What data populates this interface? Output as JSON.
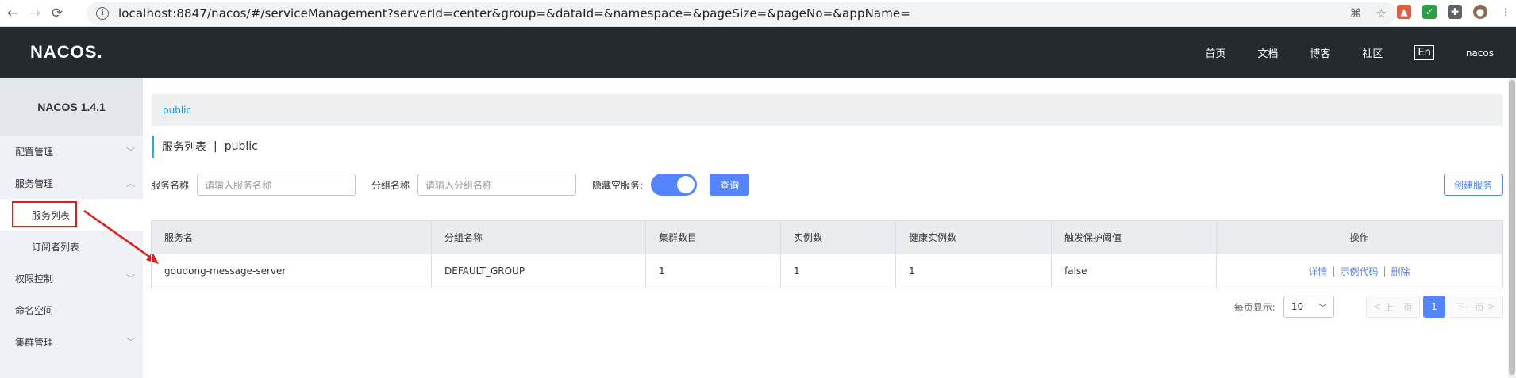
{
  "browser": {
    "url": "localhost:8847/nacos/#/serviceManagement?serverId=center&group=&dataId=&namespace=&pageSize=&pageNo=&appName="
  },
  "header": {
    "logo": "NACOS.",
    "nav": [
      "首页",
      "文档",
      "博客",
      "社区"
    ],
    "lang": "En",
    "user": "nacos"
  },
  "sidebar": {
    "title": "NACOS 1.4.1",
    "items": [
      {
        "label": "配置管理"
      },
      {
        "label": "服务管理"
      },
      {
        "label": "服务列表"
      },
      {
        "label": "订阅者列表"
      },
      {
        "label": "权限控制"
      },
      {
        "label": "命名空间"
      },
      {
        "label": "集群管理"
      }
    ]
  },
  "main": {
    "namespace_tab": "public",
    "page_title": "服务列表",
    "title_sep": "|",
    "page_namespace": "public",
    "filters": {
      "service_name_label": "服务名称",
      "service_name_placeholder": "请输入服务名称",
      "group_label": "分组名称",
      "group_placeholder": "请输入分组名称",
      "hide_empty_label": "隐藏空服务:",
      "hide_empty_on": true,
      "search_button": "查询",
      "create_button": "创建服务"
    },
    "table": {
      "headers": [
        "服务名",
        "分组名称",
        "集群数目",
        "实例数",
        "健康实例数",
        "触发保护阈值",
        "操作"
      ],
      "rows": [
        {
          "name": "goudong-message-server",
          "group": "DEFAULT_GROUP",
          "clusters": "1",
          "instances": "1",
          "healthy": "1",
          "protect": "false",
          "ops": [
            "详情",
            "示例代码",
            "删除"
          ]
        }
      ]
    },
    "pagination": {
      "label": "每页显示:",
      "page_size": "10",
      "prev": "上一页",
      "current": "1",
      "next": "下一页"
    }
  },
  "colors": {
    "accent": "#5584ff",
    "header_bg": "#252a2f",
    "annotation": "#e31b1b"
  }
}
